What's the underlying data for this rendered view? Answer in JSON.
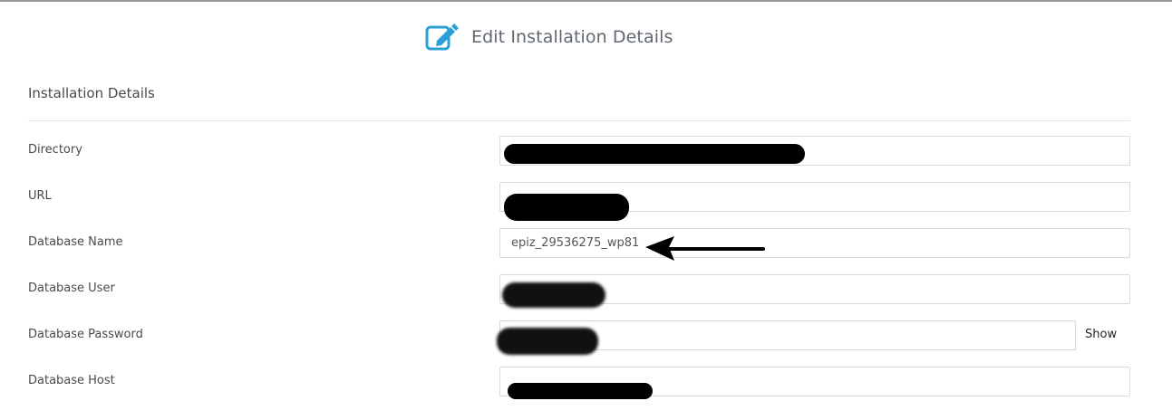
{
  "header": {
    "title": "Edit Installation Details",
    "icon": "edit-icon",
    "icon_color": "#2a9fd6"
  },
  "section": {
    "title": "Installation Details"
  },
  "fields": [
    {
      "label": "Directory",
      "value": ""
    },
    {
      "label": "URL",
      "value": ""
    },
    {
      "label": "Database Name",
      "value": "epiz_29536275_wp81"
    },
    {
      "label": "Database User",
      "value": ""
    },
    {
      "label": "Database Password",
      "value": "",
      "show_label": "Show"
    },
    {
      "label": "Database Host",
      "value": ""
    }
  ]
}
